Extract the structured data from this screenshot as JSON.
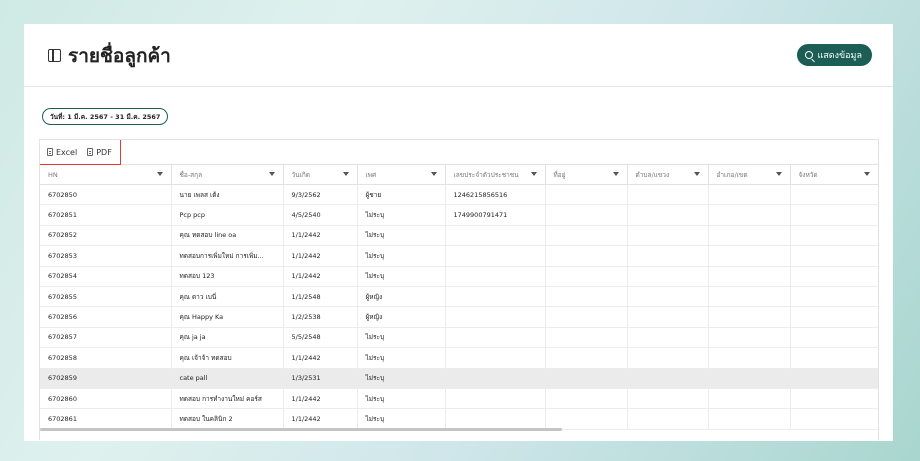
{
  "page": {
    "title": "รายชื่อลูกค้า",
    "show_button_label": "แสดงข้อมูล",
    "date_range": "วันที่: 1 มี.ค. 2567 - 31 มี.ค. 2567"
  },
  "toolbar": {
    "excel_label": "Excel",
    "pdf_label": "PDF"
  },
  "table": {
    "columns": [
      "HN",
      "ชื่อ-สกุล",
      "วันเกิด",
      "เพศ",
      "เลขประจำตัวประชาชน",
      "ที่อยู่",
      "ตำบล/แขวง",
      "อำเภอ/เขต",
      "จังหวัด"
    ],
    "rows": [
      {
        "hn": "6702850",
        "name": "นาย เพลส เต้ง",
        "dob": "9/3/2562",
        "sex": "ผู้ชาย",
        "id": "1246215856516"
      },
      {
        "hn": "6702851",
        "name": "Pcp pcp",
        "dob": "4/5/2540",
        "sex": "ไม่ระบุ",
        "id": "1749900791471"
      },
      {
        "hn": "6702852",
        "name": "คุณ ทดสอบ line oa",
        "dob": "1/1/2442",
        "sex": "ไม่ระบุ",
        "id": ""
      },
      {
        "hn": "6702853",
        "name": "ทดสอบการเพิ่มใหม่ การเพิ่ม...",
        "dob": "1/1/2442",
        "sex": "ไม่ระบุ",
        "id": ""
      },
      {
        "hn": "6702854",
        "name": "ทดสอบ 123",
        "dob": "1/1/2442",
        "sex": "ไม่ระบุ",
        "id": ""
      },
      {
        "hn": "6702855",
        "name": "คุณ ดาว เบนี่",
        "dob": "1/1/2548",
        "sex": "ผู้หญิง",
        "id": ""
      },
      {
        "hn": "6702856",
        "name": "คุณ Happy Ka",
        "dob": "1/2/2538",
        "sex": "ผู้หญิง",
        "id": ""
      },
      {
        "hn": "6702857",
        "name": "คุณ ja ja",
        "dob": "5/5/2548",
        "sex": "ไม่ระบุ",
        "id": ""
      },
      {
        "hn": "6702858",
        "name": "คุณ เจ้าจ้า ทดสอบ",
        "dob": "1/1/2442",
        "sex": "ไม่ระบุ",
        "id": ""
      },
      {
        "hn": "6702859",
        "name": "cate pall",
        "dob": "1/3/2531",
        "sex": "ไม่ระบุ",
        "id": ""
      },
      {
        "hn": "6702860",
        "name": "ทดสอบ การทำงานใหม่ คอร์ส",
        "dob": "1/1/2442",
        "sex": "ไม่ระบุ",
        "id": ""
      },
      {
        "hn": "6702861",
        "name": "ทดสอบ ในคลินิก 2",
        "dob": "1/1/2442",
        "sex": "ไม่ระบุ",
        "id": ""
      }
    ],
    "highlighted_row_index": 9
  },
  "colors": {
    "accent": "#1c5e55",
    "highlight_box": "#e53935"
  }
}
